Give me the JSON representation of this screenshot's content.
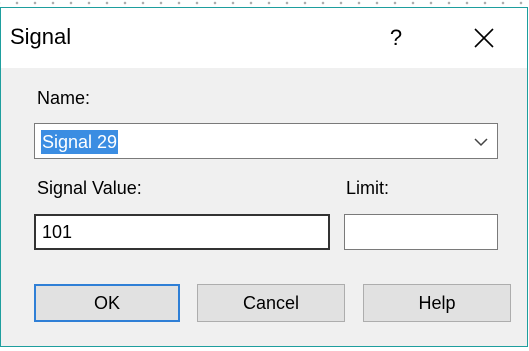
{
  "dialog": {
    "title": "Signal",
    "help_glyph": "?",
    "close_icon": "close-icon",
    "accent_color": "#1e9e9e"
  },
  "name_field": {
    "label": "Name:",
    "value": "Signal 29",
    "selection_color": "#3b8de2",
    "dropdown_icon": "chevron-down-icon"
  },
  "signal_value_field": {
    "label": "Signal Value:",
    "value": "101"
  },
  "limit_field": {
    "label": "Limit:",
    "value": ""
  },
  "buttons": {
    "ok": "OK",
    "cancel": "Cancel",
    "help": "Help"
  }
}
